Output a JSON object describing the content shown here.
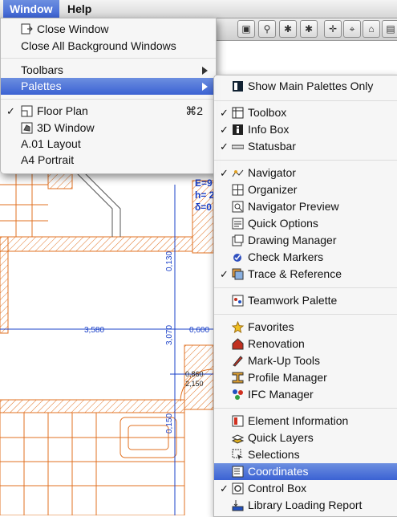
{
  "menubar": {
    "window": "Window",
    "help": "Help"
  },
  "drawing": {
    "dim_labels": [
      "3,580",
      "0,600",
      "3,070",
      "0,130",
      "0,150",
      "0,860",
      "2,150",
      "E=9",
      "h= 2",
      "δ=0"
    ]
  },
  "window_menu": {
    "close_window": "Close Window",
    "close_all": "Close All Background Windows",
    "toolbars": "Toolbars",
    "palettes": "Palettes",
    "floor_plan": "Floor Plan",
    "floor_plan_shortcut": "⌘2",
    "window_3d": "3D Window",
    "layout_a01": "A.01 Layout",
    "a4_portrait": "A4 Portrait"
  },
  "palettes_menu": {
    "show_main": "Show Main Palettes Only",
    "toolbox": "Toolbox",
    "info_box": "Info Box",
    "statusbar": "Statusbar",
    "navigator": "Navigator",
    "organizer": "Organizer",
    "navigator_preview": "Navigator Preview",
    "quick_options": "Quick Options",
    "drawing_manager": "Drawing Manager",
    "check_markers": "Check Markers",
    "trace_reference": "Trace & Reference",
    "teamwork": "Teamwork Palette",
    "favorites": "Favorites",
    "renovation": "Renovation",
    "markup_tools": "Mark-Up Tools",
    "profile_manager": "Profile Manager",
    "ifc_manager": "IFC Manager",
    "element_information": "Element Information",
    "quick_layers": "Quick Layers",
    "selections": "Selections",
    "coordinates": "Coordinates",
    "control_box": "Control Box",
    "library_loading_report": "Library Loading Report"
  },
  "checkmark": "✓",
  "colors": {
    "highlight": "#3b62d3",
    "drawing": "#e07020",
    "dimension": "#1a40c8"
  }
}
